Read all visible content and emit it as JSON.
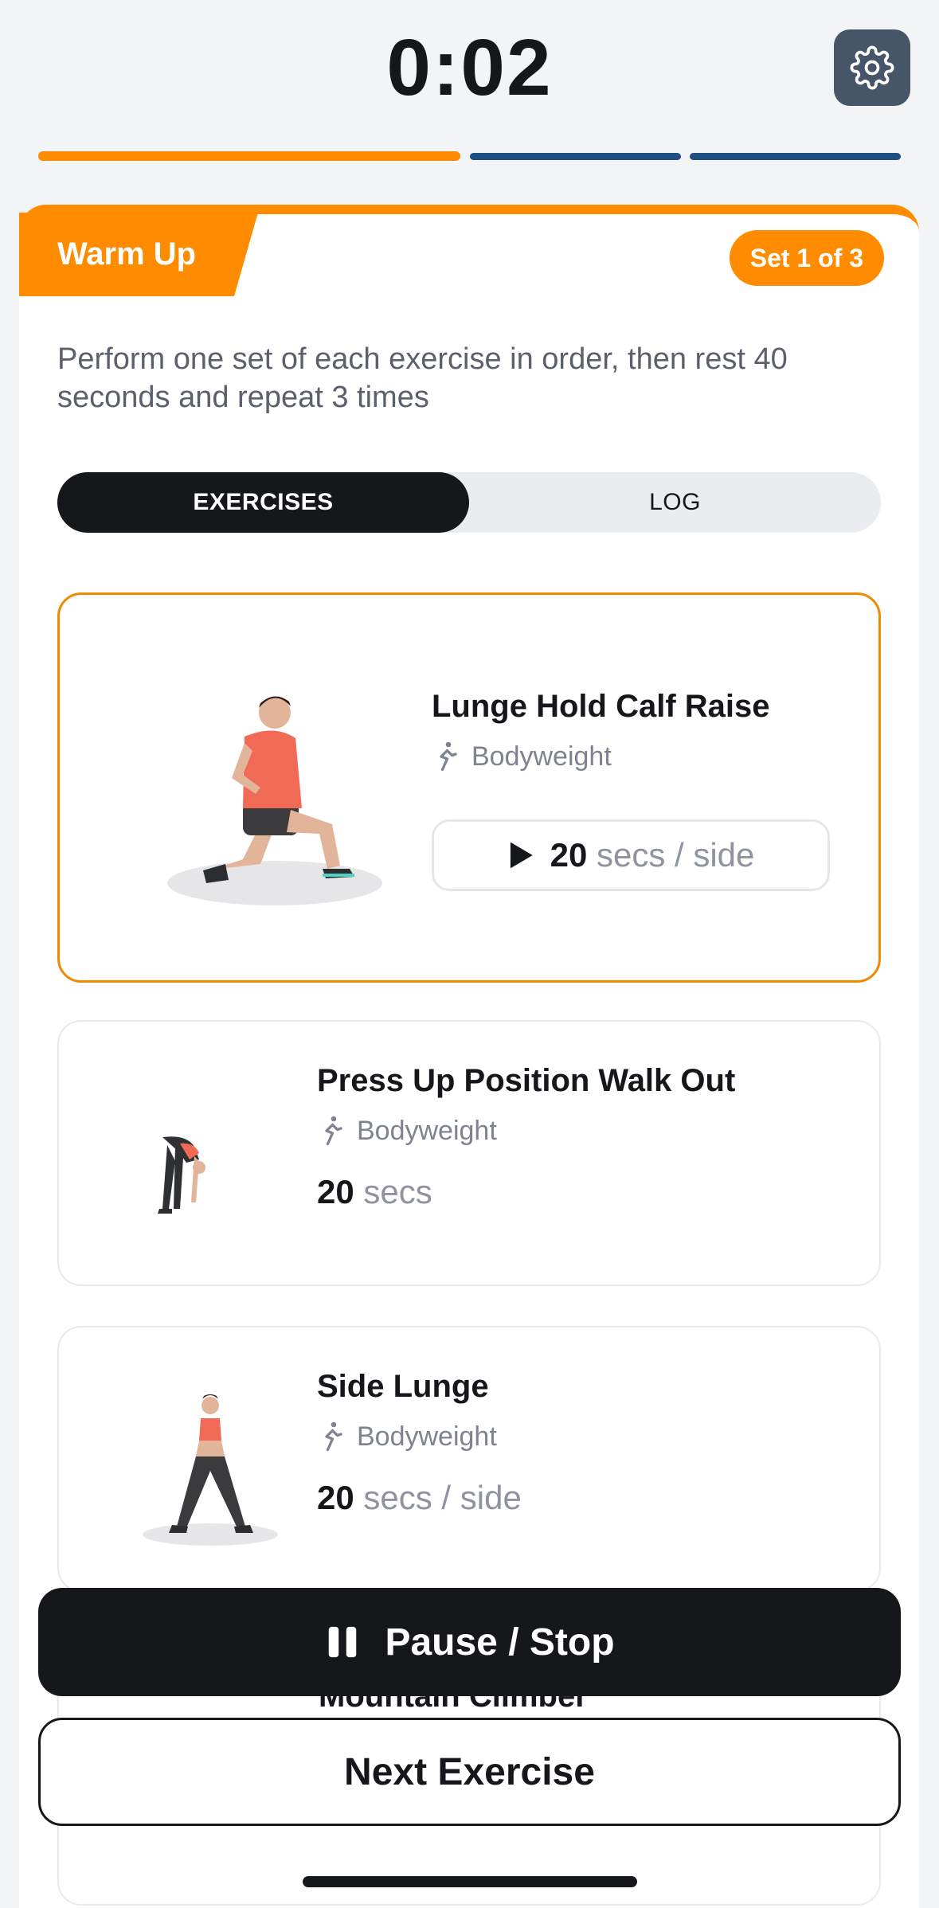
{
  "header": {
    "timer": "0:02",
    "progress_segments": 3,
    "current_segment_progress": 1.0
  },
  "section": {
    "tag": "Warm Up",
    "set_badge": "Set 1 of 3",
    "instructions": "Perform one set of each exercise in order, then rest 40 seconds and repeat 3 times"
  },
  "tabs": {
    "exercises": "EXERCISES",
    "log": "LOG",
    "active": "EXERCISES"
  },
  "exercises": [
    {
      "title": "Lunge Hold Calf Raise",
      "equipment": "Bodyweight",
      "duration_value": "20",
      "duration_unit": "secs / side",
      "current": true
    },
    {
      "title": "Press Up Position Walk Out",
      "equipment": "Bodyweight",
      "duration_value": "20",
      "duration_unit": "secs",
      "current": false
    },
    {
      "title": "Side Lunge",
      "equipment": "Bodyweight",
      "duration_value": "20",
      "duration_unit": "secs / side",
      "current": false
    },
    {
      "title": "Mountain Climber",
      "equipment": "",
      "duration_value": "",
      "duration_unit": "",
      "current": false
    }
  ],
  "buttons": {
    "pause_stop": "Pause / Stop",
    "next_exercise": "Next Exercise"
  },
  "colors": {
    "accent": "#ff8c00",
    "dark": "#16171a",
    "progress_upcoming": "#1e4f80",
    "settings_bg": "#475569"
  },
  "icons": [
    "gear-icon",
    "play-icon",
    "pause-icon",
    "bodyweight-icon"
  ]
}
